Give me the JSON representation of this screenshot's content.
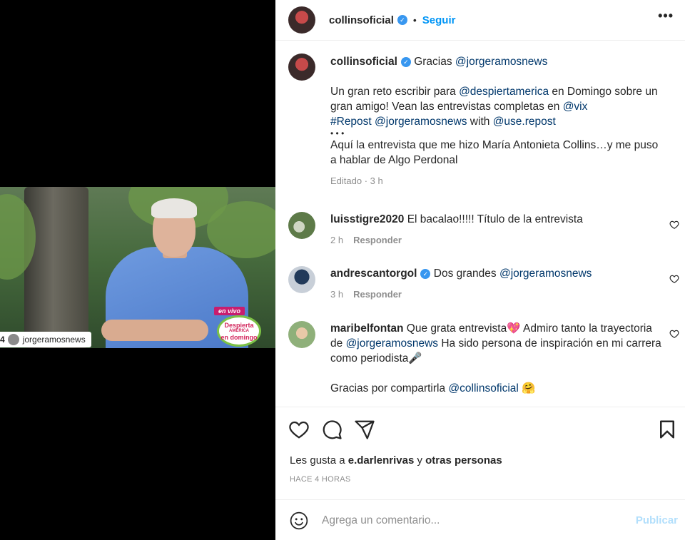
{
  "post": {
    "author": "collinsoficial",
    "separator": "•",
    "follow_label": "Seguir",
    "more_label": "•••"
  },
  "media": {
    "badge_live": "en vivo",
    "badge_line1": "Despierta",
    "badge_line2": "AMÉRICA",
    "badge_line3": "en domingo",
    "tag_number": "4",
    "tag_user": "jorgeramosnews"
  },
  "caption": {
    "author": "collinsoficial",
    "line1_text": "Gracias ",
    "line1_mention": "@jorgeramosnews",
    "p1_a": "Un gran reto escribir para ",
    "p1_m1": "@despiertamerica",
    "p1_b": " en Domingo sobre un gran amigo! Vean las entrevistas completas en ",
    "p1_m2": "@vix",
    "p1_m3": "#Repost",
    "p1_m4": "@jorgeramosnews",
    "p1_c": " with ",
    "p1_m5": "@use.repost",
    "dots": "•   •   •",
    "p2": "Aquí la entrevista que me hizo María Antonieta Collins…y me puso a hablar de Algo Perdonal",
    "meta": "Editado · 3 h"
  },
  "comments": [
    {
      "user": "luisstigre2020",
      "text": "El bacalao!!!!! Título de la entrevista",
      "time": "2 h",
      "reply": "Responder"
    },
    {
      "user": "andrescantorgol",
      "text_a": "Dos grandes ",
      "mention": "@jorgeramosnews",
      "time": "3 h",
      "reply": "Responder"
    },
    {
      "user": "maribelfontan",
      "text_a": "Que grata entrevista",
      "emoji1": "💖",
      "text_b": " Admiro tanto la trayectoria de ",
      "mention1": "@jorgeramosnews",
      "text_c": " Ha sido persona de inspiración en mi carrera como periodista",
      "emoji2": "🎤",
      "text_d": "Gracias por compartirla ",
      "mention2": "@collinsoficial",
      "emoji3": "🤗"
    }
  ],
  "likes": {
    "prefix": "Les gusta a ",
    "user": "e.darlenrivas",
    "middle": " y ",
    "others": "otras personas"
  },
  "time_label": "HACE 4 HORAS",
  "comment_box": {
    "placeholder": "Agrega un comentario...",
    "publish_label": "Publicar"
  },
  "icons": {
    "like": "heart-icon",
    "comment": "comment-bubble-icon",
    "share": "paper-plane-icon",
    "save": "bookmark-icon",
    "emoji": "smiley-icon",
    "verified": "verified-badge-icon",
    "more": "more-options-icon"
  },
  "colors": {
    "link_blue": "#0095f6",
    "mention_blue": "#00376b",
    "verified_blue": "#3897f0",
    "publish_disabled": "#b2dffc",
    "muted_text": "#8e8e8e"
  }
}
